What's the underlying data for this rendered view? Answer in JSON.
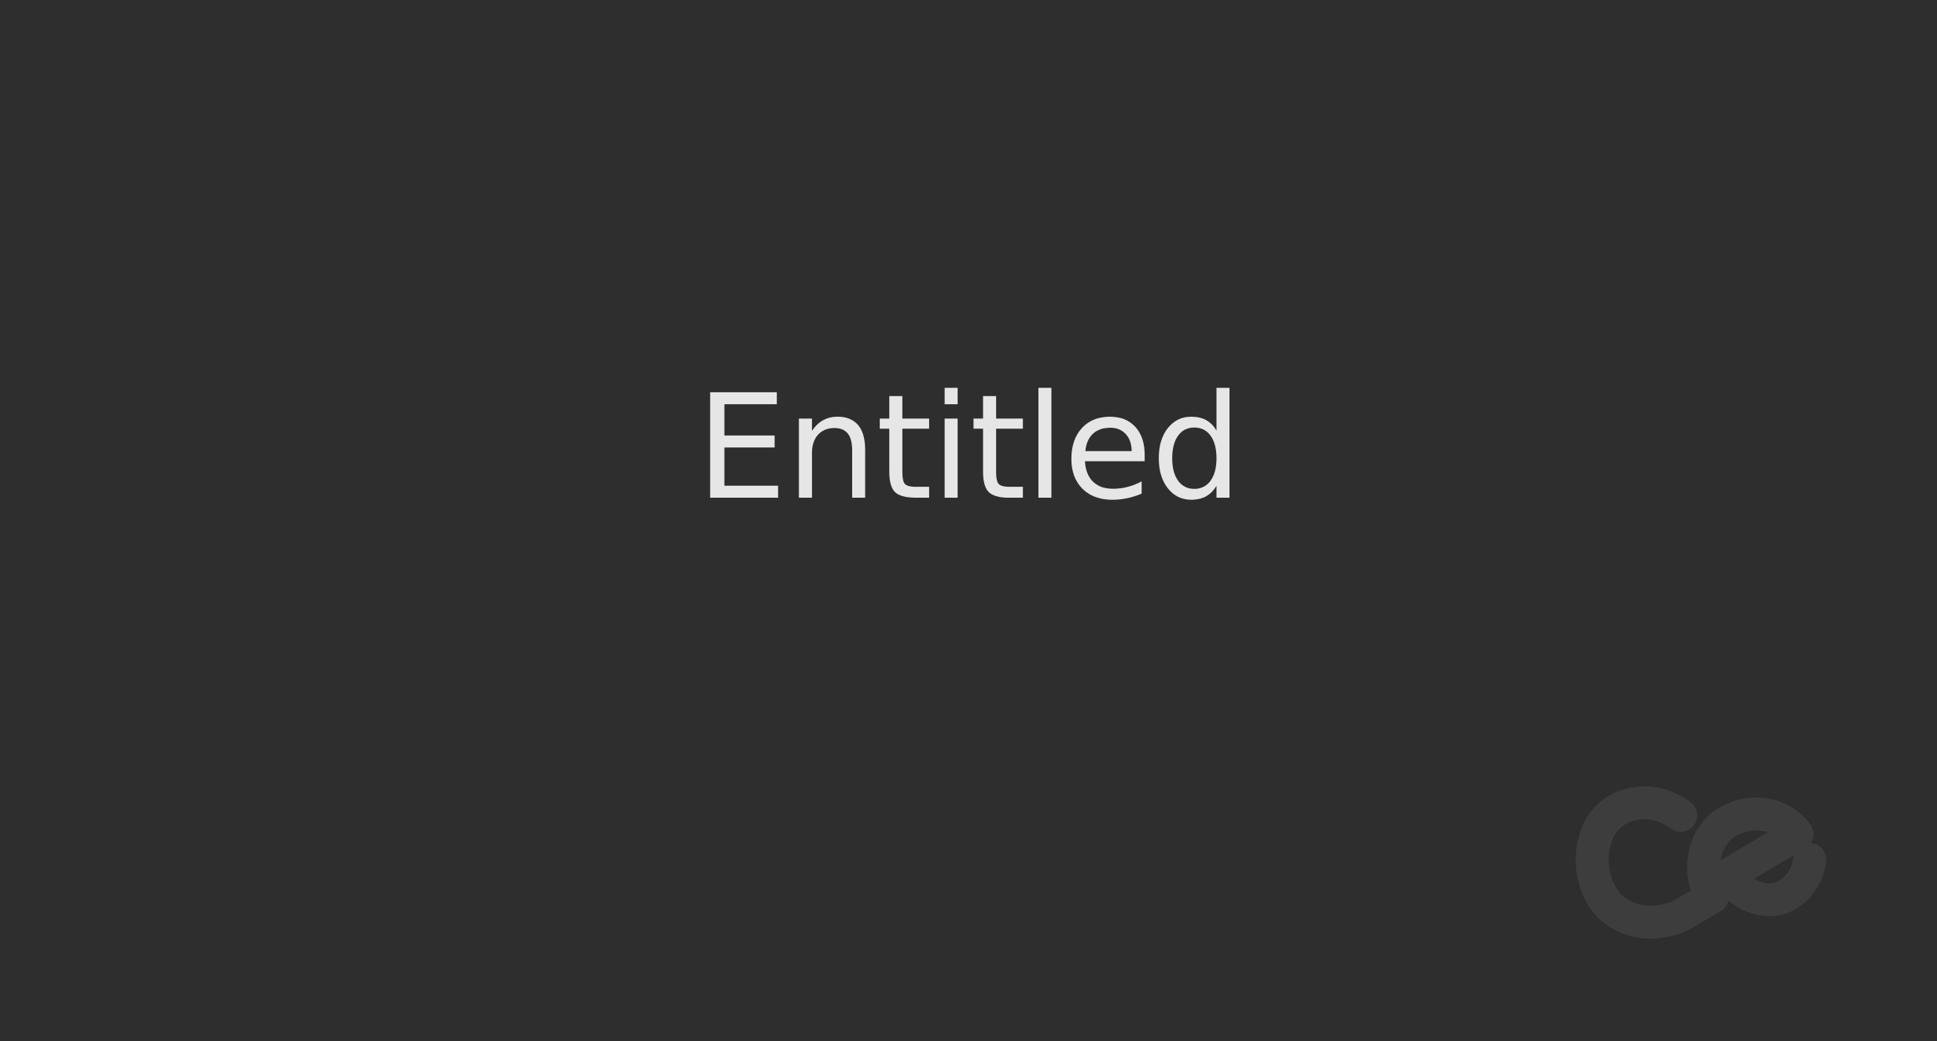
{
  "app": {
    "title": "Entitled"
  },
  "logo": {
    "icon": "ce-logo-icon",
    "text": "ce"
  },
  "colors": {
    "background": "#2e2e2e",
    "title": "#e6e6e6",
    "logo": "#3d3d3d"
  }
}
